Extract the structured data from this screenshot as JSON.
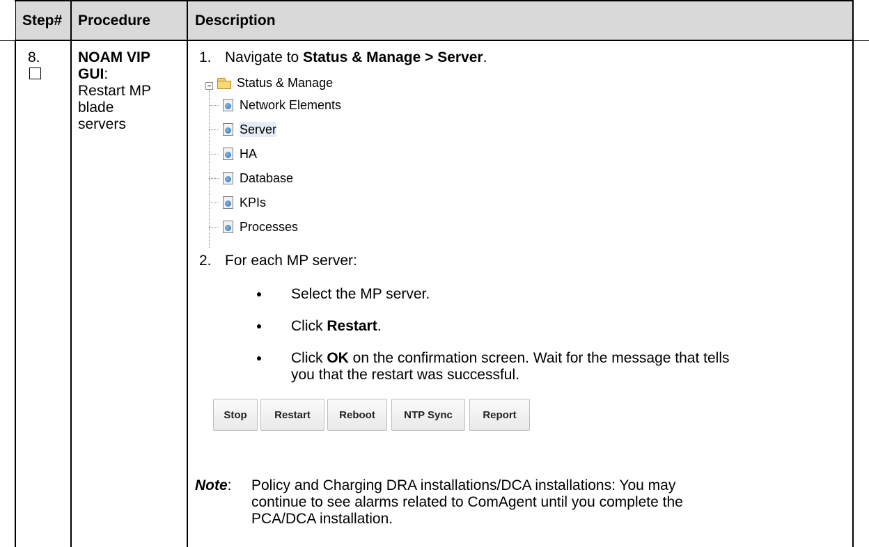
{
  "table": {
    "headers": {
      "step": "Step#",
      "procedure": "Procedure",
      "description": "Description"
    },
    "row": {
      "step_number": "8.",
      "procedure_title": "NOAM VIP GUI",
      "procedure_title_line1": "NOAM VIP",
      "procedure_title_line2": "GUI",
      "procedure_colon": ":",
      "procedure_text_line1": "Restart MP",
      "procedure_text_line2": "blade",
      "procedure_text_line3": "servers"
    }
  },
  "steps": {
    "s1_num": "1.",
    "s1_prefix": "Navigate to ",
    "s1_bold": "Status & Manage > Server",
    "s1_suffix": ".",
    "s2_num": "2.",
    "s2_text": "For each MP server:",
    "bullets": {
      "b1": "Select the MP server.",
      "b2_prefix": "Click ",
      "b2_bold": "Restart",
      "b2_suffix": ".",
      "b3_prefix": "Click ",
      "b3_bold": "OK",
      "b3_suffix": " on the confirmation screen.  Wait for the message that tells",
      "b3_line2": "you that the restart was successful."
    }
  },
  "tree": {
    "root": "Status & Manage",
    "items": [
      "Network Elements",
      "Server",
      "HA",
      "Database",
      "KPIs",
      "Processes"
    ],
    "selected": "Server"
  },
  "buttons": {
    "stop": "Stop",
    "restart": "Restart",
    "reboot": "Reboot",
    "ntp_sync": "NTP Sync",
    "report": "Report"
  },
  "note": {
    "label": "Note",
    "colon": ":",
    "line1": "Policy and Charging DRA installations/DCA installations:  You may",
    "line2": "continue to see alarms related to ComAgent until you complete the",
    "line3": "PCA/DCA installation."
  }
}
